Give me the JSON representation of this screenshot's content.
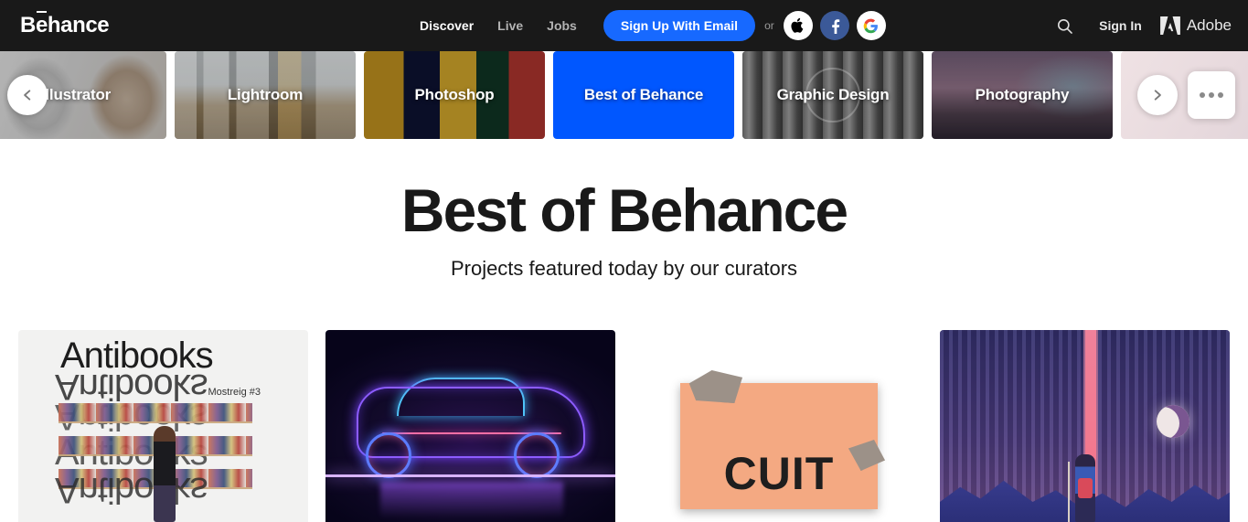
{
  "header": {
    "logo": "Behance",
    "nav_links": [
      {
        "label": "Discover",
        "active": true
      },
      {
        "label": "Live",
        "active": false
      },
      {
        "label": "Jobs",
        "active": false
      }
    ],
    "signup_label": "Sign Up With Email",
    "or_label": "or",
    "social": [
      {
        "name": "apple",
        "glyph": ""
      },
      {
        "name": "facebook",
        "glyph": "f"
      },
      {
        "name": "google",
        "glyph": "G"
      }
    ],
    "search_icon": "search-icon",
    "signin_label": "Sign In",
    "adobe_label": "Adobe",
    "background_color": "#191919",
    "accent_color": "#1769ff"
  },
  "carousel": {
    "prev_label": "‹",
    "next_label": "›",
    "more_label": "•••",
    "active_color": "#0057ff",
    "cards": [
      {
        "label": "Illustrator",
        "active": false,
        "art": "art-illustrator",
        "partial": true
      },
      {
        "label": "Lightroom",
        "active": false,
        "art": "art-lightroom",
        "partial": false
      },
      {
        "label": "Photoshop",
        "active": false,
        "art": "art-photoshop",
        "partial": false
      },
      {
        "label": "Best of Behance",
        "active": true,
        "art": "art-best",
        "partial": false
      },
      {
        "label": "Graphic Design",
        "active": false,
        "art": "art-graphic",
        "partial": false
      },
      {
        "label": "Photography",
        "active": false,
        "art": "art-photography",
        "partial": false
      },
      {
        "label": "",
        "active": false,
        "art": "art-partial",
        "partial": true
      }
    ]
  },
  "main": {
    "title": "Best of Behance",
    "subtitle": "Projects featured today by our curators"
  },
  "projects": [
    {
      "name": "antibooks",
      "overlay_title": "Antibooks",
      "overlay_subtitle": "Mostreig #3"
    },
    {
      "name": "neon-car",
      "overlay_title": "",
      "overlay_subtitle": ""
    },
    {
      "name": "cuit",
      "overlay_title": "CUIT",
      "overlay_subtitle": ""
    },
    {
      "name": "curtain-moon",
      "overlay_title": "",
      "overlay_subtitle": ""
    }
  ]
}
